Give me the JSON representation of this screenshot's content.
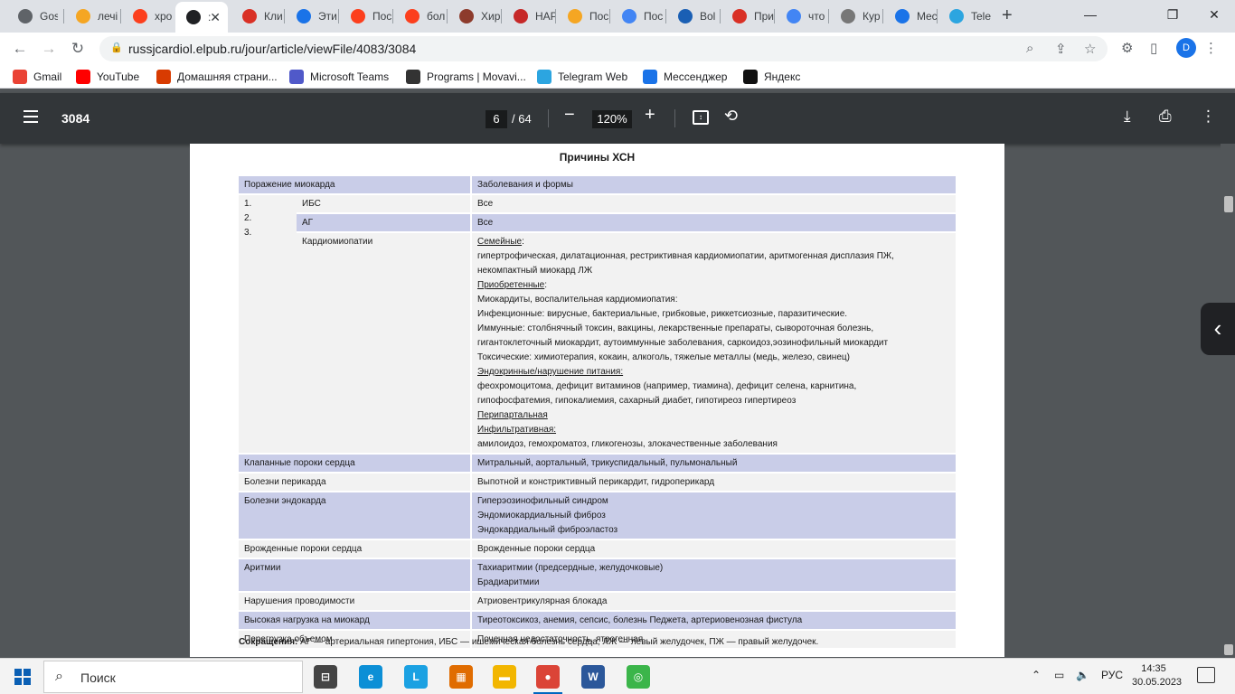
{
  "browser": {
    "tabs": [
      {
        "label": "Gos",
        "icon": "globe-icon",
        "color": "#5f6368"
      },
      {
        "label": "лечі",
        "icon": "images-icon",
        "color": "#f5a623"
      },
      {
        "label": "хро",
        "icon": "yandex-icon",
        "color": "#fc3f1d"
      },
      {
        "label": ":",
        "icon": "elpub-icon",
        "color": "#202124",
        "active": true
      },
      {
        "label": "Кли",
        "icon": "heart-icon",
        "color": "#d93025"
      },
      {
        "label": "Эти",
        "icon": "s-icon",
        "color": "#1a73e8"
      },
      {
        "label": "Пос",
        "icon": "yandex-icon",
        "color": "#fc3f1d"
      },
      {
        "label": "бол",
        "icon": "yandex-icon",
        "color": "#fc3f1d"
      },
      {
        "label": "Хир",
        "icon": "book-icon",
        "color": "#8d3b2c"
      },
      {
        "label": "НАР",
        "icon": "drop-icon",
        "color": "#c62828"
      },
      {
        "label": "Пос",
        "icon": "images-icon",
        "color": "#f5a623"
      },
      {
        "label": "Пос",
        "icon": "google-icon",
        "color": "#4285f4"
      },
      {
        "label": "Bol",
        "icon": "owl-icon",
        "color": "#1a5fb4"
      },
      {
        "label": "При",
        "icon": "arc-icon",
        "color": "#d93025"
      },
      {
        "label": "что",
        "icon": "google-icon",
        "color": "#4285f4"
      },
      {
        "label": "Кур",
        "icon": "site-icon",
        "color": "#777777"
      },
      {
        "label": "Mec",
        "icon": "messenger-icon",
        "color": "#1a73e8"
      },
      {
        "label": "Tele",
        "icon": "telegram-icon",
        "color": "#2ca5e0"
      }
    ],
    "url": "russjcardiol.elpub.ru/jour/article/viewFile/4083/3084",
    "profile_initial": "D",
    "bookmarks": [
      {
        "label": "Gmail",
        "icon": "gmail-icon",
        "color": "#ea4335"
      },
      {
        "label": "YouTube",
        "icon": "youtube-icon",
        "color": "#ff0000"
      },
      {
        "label": "Домашняя страни...",
        "icon": "office-icon",
        "color": "#d83b01"
      },
      {
        "label": "Microsoft Teams",
        "icon": "teams-icon",
        "color": "#5059c9"
      },
      {
        "label": "Programs | Movavi...",
        "icon": "movavi-icon",
        "color": "#333333"
      },
      {
        "label": "Telegram Web",
        "icon": "telegram-icon",
        "color": "#2ca5e0"
      },
      {
        "label": "Мессенджер",
        "icon": "messenger-icon",
        "color": "#1a73e8"
      },
      {
        "label": "Яндекс",
        "icon": "yandex-browser-icon",
        "color": "#111111"
      }
    ]
  },
  "pdf": {
    "title": "3084",
    "page": "6",
    "total": "/ 64",
    "zoom": "120%",
    "heading": "Причины ХСН",
    "header_row": [
      "Поражение миокарда",
      "Заболевания и формы"
    ],
    "numbers": [
      "1.",
      "2.",
      "3."
    ],
    "sub_rows": [
      {
        "name": "ИБС",
        "forms": [
          "Все"
        ]
      },
      {
        "name": "АГ",
        "forms": [
          "Все"
        ]
      }
    ],
    "cardiomyopathy": {
      "name": "Кардиомиопатии",
      "lines": [
        {
          "text": "Семейные",
          "u": true,
          "suffix": ":"
        },
        {
          "text": "гипертрофическая, дилатационная, рестриктивная кардиомиопатии, аритмогенная дисплазия ПЖ,"
        },
        {
          "text": "некомпактный миокард ЛЖ"
        },
        {
          "text": "Приобретенные",
          "u": true,
          "suffix": ":"
        },
        {
          "text": "Миокардиты, воспалительная кардиомиопатия:"
        },
        {
          "text": "Инфекционные: вирусные, бактериальные, грибковые, риккетсиозные, паразитические."
        },
        {
          "text": "Иммунные: столбнячный токсин, вакцины, лекарственные препараты, сывороточная болезнь,"
        },
        {
          "text": "гигантоклеточный миокардит, аутоиммунные заболевания, саркоидоз,эозинофильный миокардит"
        },
        {
          "text": "Токсические: химиотерапия, кокаин, алкоголь, тяжелые металлы (медь, железо, свинец)"
        },
        {
          "text": "Эндокринные/нарушение питания:",
          "u": true
        },
        {
          "text": "феохромоцитома, дефицит витаминов (например, тиамина), дефицит селена, карнитина,"
        },
        {
          "text": "гипофосфатемия, гипокалиемия, сахарный диабет, гипотиреоз гипертиреоз"
        },
        {
          "text": "Перипартальная",
          "u": true
        },
        {
          "text": "Инфильтративная:",
          "u": true
        },
        {
          "text": "амилоидоз, гемохроматоз, гликогенозы, злокачественные заболевания"
        }
      ]
    },
    "rows": [
      {
        "name": "Клапанные пороки сердца",
        "forms": [
          "Митральный, аортальный, трикуспидальный, пульмональный"
        ]
      },
      {
        "name": "Болезни перикарда",
        "forms": [
          "Выпотной и констриктивный перикардит, гидроперикард"
        ]
      },
      {
        "name": "Болезни эндокарда",
        "forms": [
          "Гиперэозинофильный синдром",
          "Эндомиокардиальный фиброз",
          "Эндокардиальный фиброэластоз"
        ]
      },
      {
        "name": "Врожденные пороки сердца",
        "forms": [
          "Врожденные пороки сердца"
        ]
      },
      {
        "name": "Аритмии",
        "forms": [
          "Тахиаритмии (предсердные, желудочковые)",
          "Брадиаритмии"
        ]
      },
      {
        "name": "Нарушения проводимости",
        "forms": [
          "Атриовентрикулярная блокада"
        ]
      },
      {
        "name": "Высокая нагрузка на миокард",
        "forms": [
          "Тиреотоксикоз, анемия, сепсис, болезнь Педжета, артериовенозная фистула"
        ]
      },
      {
        "name": "Перегрузка объемом",
        "forms": [
          "Почечная недостаточность, ятрогенная"
        ]
      }
    ],
    "footnote_label": "Сокращения:",
    "footnote_text": " АГ — артериальная гипертония, ИБС — ишемическая болезнь сердца, ЛЖ — левый желудочек, ПЖ — правый желудочек."
  },
  "taskbar": {
    "search_placeholder": "Поиск",
    "apps": [
      {
        "name": "task-view-icon",
        "label": "⊟",
        "color": "#444444"
      },
      {
        "name": "edge-icon",
        "label": "e",
        "color": "#0c8fd6"
      },
      {
        "name": "l-app-icon",
        "label": "L",
        "color": "#1ba1e2"
      },
      {
        "name": "store-icon",
        "label": "▦",
        "color": "#e06c00"
      },
      {
        "name": "explorer-icon",
        "label": "▬",
        "color": "#f2b600"
      },
      {
        "name": "chrome-icon",
        "label": "●",
        "color": "#db4437"
      },
      {
        "name": "word-icon",
        "label": "W",
        "color": "#2b579a"
      },
      {
        "name": "green-app-icon",
        "label": "◎",
        "color": "#3bb54a"
      }
    ],
    "lang": "РУС",
    "time": "14:35",
    "date": "30.05.2023"
  }
}
